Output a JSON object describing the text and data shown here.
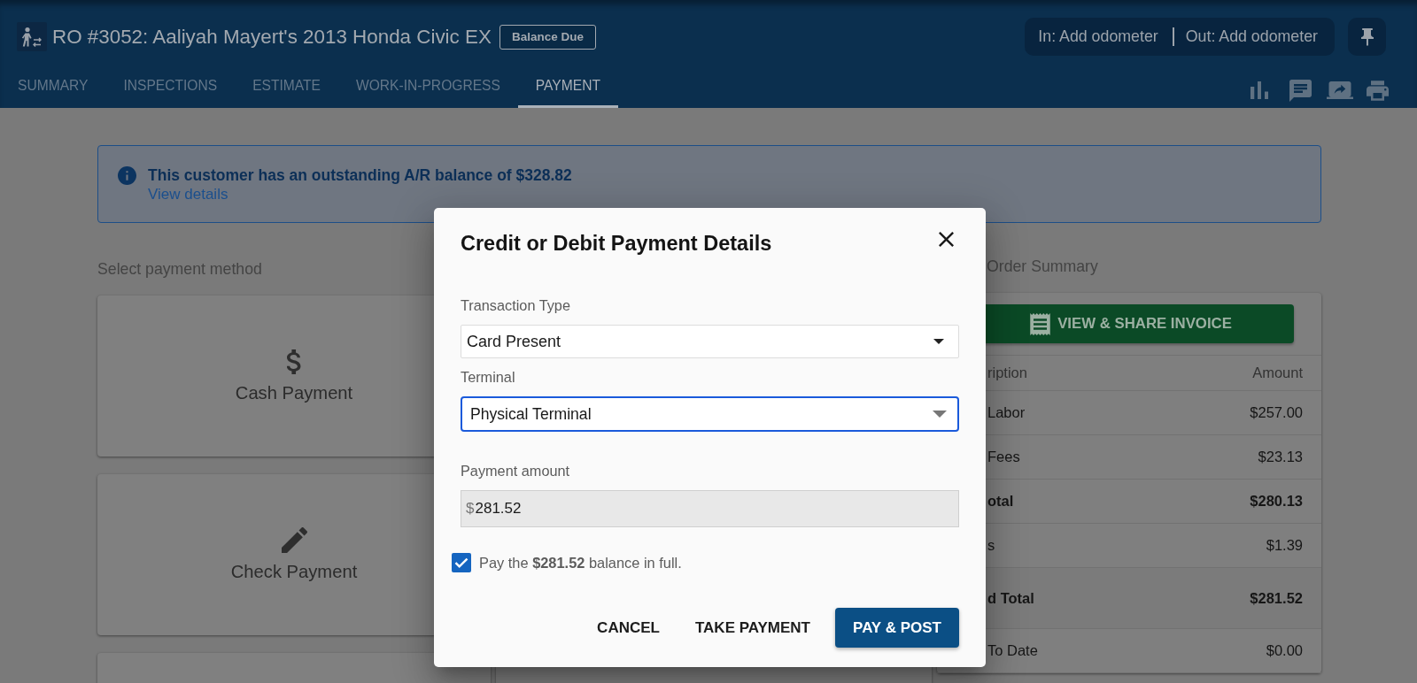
{
  "header": {
    "title": "RO #3052: Aaliyah Mayert's 2013 Honda Civic EX",
    "badge": "Balance Due",
    "odometer": [
      "In: Add odometer",
      "Out: Add odometer"
    ],
    "tabs": [
      {
        "label": "SUMMARY",
        "selected": false
      },
      {
        "label": "INSPECTIONS",
        "selected": false
      },
      {
        "label": "ESTIMATE",
        "selected": false
      },
      {
        "label": "WORK-IN-PROGRESS",
        "selected": false
      },
      {
        "label": "PAYMENT",
        "selected": true
      }
    ]
  },
  "alert": {
    "message": "This customer has an outstanding A/R balance of $328.82",
    "link": "View details"
  },
  "payment_methods": {
    "heading": "Select payment method",
    "items": [
      {
        "kind": "cash",
        "label": "Cash Payment"
      },
      {
        "kind": "check",
        "label": "Check Payment"
      }
    ]
  },
  "order_summary": {
    "heading": "Order Summary",
    "invoice_button": "VIEW & SHARE INVOICE",
    "columns": [
      "ription",
      "Amount"
    ],
    "rows": [
      {
        "kind": "line",
        "description": "Labor",
        "amount": "$257.00"
      },
      {
        "kind": "line",
        "description": "Fees",
        "amount": "$23.13"
      },
      {
        "kind": "subtotal",
        "description": "otal",
        "amount": "$280.13"
      },
      {
        "kind": "line",
        "description": "s",
        "amount": "$1.39"
      },
      {
        "kind": "grand_total",
        "description": "d Total",
        "amount": "$281.52"
      },
      {
        "kind": "line",
        "description": "To Date",
        "amount": "$0.00"
      }
    ]
  },
  "dialog": {
    "title": "Credit or Debit Payment Details",
    "fields": [
      {
        "kind": "select",
        "label": "Transaction Type",
        "value": "Card Present",
        "focused": false
      },
      {
        "kind": "select",
        "label": "Terminal",
        "value": "Physical Terminal",
        "focused": true
      },
      {
        "kind": "amount",
        "label": "Payment amount",
        "prefix": "$",
        "value": "281.52",
        "disabled": true
      }
    ],
    "checkbox": {
      "label": "Pay the **$281.52** balance in full.",
      "checked": true
    },
    "buttons": [
      {
        "kind": "text",
        "label": "CANCEL"
      },
      {
        "kind": "text",
        "label": "TAKE PAYMENT"
      },
      {
        "kind": "primary",
        "label": "PAY & POST"
      }
    ]
  }
}
